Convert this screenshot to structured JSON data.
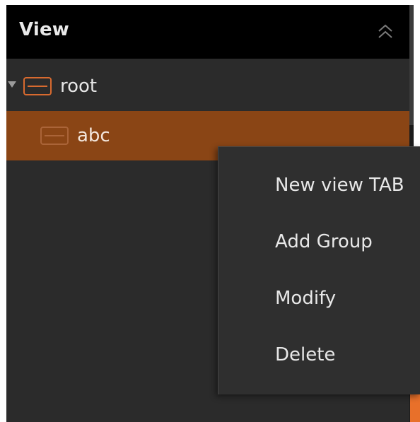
{
  "panel": {
    "title": "View",
    "collapse_icon": "double-chevron-up-icon"
  },
  "tree": {
    "items": [
      {
        "label": "root",
        "icon": "group-icon",
        "expanded": true,
        "selected": false
      },
      {
        "label": "abc",
        "icon": "group-icon",
        "selected": true
      }
    ]
  },
  "context_menu": {
    "items": [
      {
        "label": "New view TAB"
      },
      {
        "label": "Add Group"
      },
      {
        "label": "Modify"
      },
      {
        "label": "Delete"
      }
    ]
  },
  "colors": {
    "panel_bg": "#2b2b2b",
    "header_bg": "#000000",
    "selection_bg": "#8a4515",
    "accent": "#d86a2f",
    "menu_bg": "#2f2f2f",
    "text": "#e8e8e8"
  }
}
